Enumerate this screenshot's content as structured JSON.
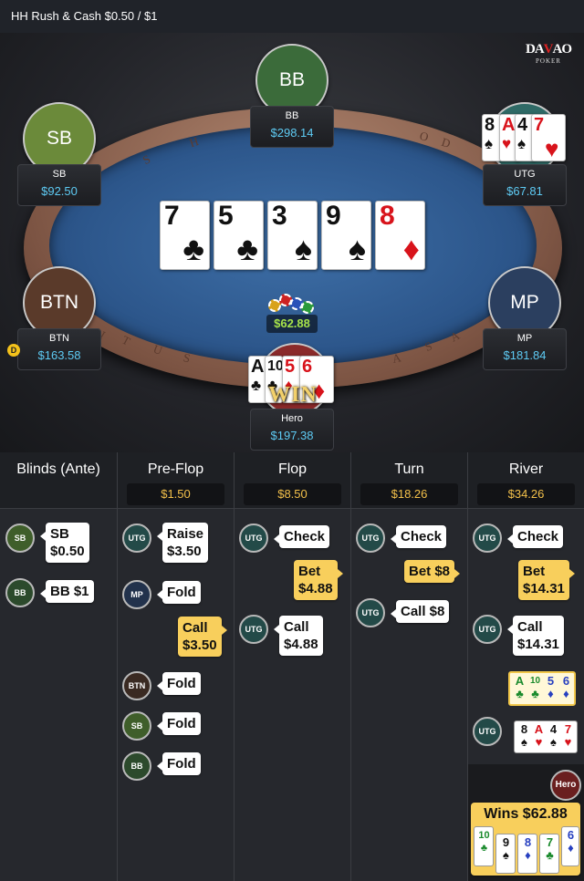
{
  "title": "HH  Rush & Cash $0.50 / $1",
  "logo": {
    "text_a": "DA",
    "text_b": "V",
    "text_c": "AO",
    "sub": "POKER"
  },
  "rail_text": [
    "S",
    "H",
    "O",
    "D",
    "I",
    "T",
    "U",
    "S",
    "A",
    "S",
    "A"
  ],
  "seats": {
    "bb": {
      "avatar": "BB",
      "name": "BB",
      "stack": "$298.14",
      "color": "#3b6b3a"
    },
    "sb": {
      "avatar": "SB",
      "name": "SB",
      "stack": "$92.50",
      "color": "#6b8a3a"
    },
    "utg": {
      "name": "UTG",
      "stack": "$67.81",
      "color": "#2f6a66"
    },
    "btn": {
      "avatar": "BTN",
      "name": "BTN",
      "stack": "$163.58",
      "color": "#5a3a2a"
    },
    "mp": {
      "avatar": "MP",
      "name": "MP",
      "stack": "$181.84",
      "color": "#2b3f5f"
    },
    "hero": {
      "name": "Hero",
      "stack": "$197.38",
      "color": "#8a2a2a"
    }
  },
  "board": [
    {
      "rank": "7",
      "suit": "♣",
      "color": "blk"
    },
    {
      "rank": "5",
      "suit": "♣",
      "color": "blk"
    },
    {
      "rank": "3",
      "suit": "♠",
      "color": "blk"
    },
    {
      "rank": "9",
      "suit": "♠",
      "color": "blk"
    },
    {
      "rank": "8",
      "suit": "♦",
      "color": "red"
    }
  ],
  "utg_hand": [
    {
      "rank": "8",
      "suit": "♠",
      "color": "blk"
    },
    {
      "rank": "A",
      "suit": "♥",
      "color": "red"
    },
    {
      "rank": "4",
      "suit": "♠",
      "color": "blk"
    },
    {
      "rank": "7",
      "suit": "♥",
      "color": "red"
    }
  ],
  "hero_hand": [
    {
      "rank": "A",
      "suit": "♣",
      "color": "blk"
    },
    {
      "rank": "10",
      "suit": "♣",
      "color": "blk"
    },
    {
      "rank": "5",
      "suit": "♦",
      "color": "red"
    },
    {
      "rank": "6",
      "suit": "♦",
      "color": "red"
    }
  ],
  "pot": "$62.88",
  "dealer": "D",
  "win_label": "WIN",
  "columns": [
    {
      "title": "Blinds (Ante)",
      "pot": ""
    },
    {
      "title": "Pre-Flop",
      "pot": "$1.50"
    },
    {
      "title": "Flop",
      "pot": "$8.50"
    },
    {
      "title": "Turn",
      "pot": "$18.26"
    },
    {
      "title": "River",
      "pot": "$34.26"
    }
  ],
  "actions": {
    "blinds": [
      {
        "pos": "SB",
        "l1": "SB",
        "l2": "$0.50"
      },
      {
        "pos": "BB",
        "l1": "BB  $1"
      }
    ],
    "preflop": [
      {
        "pos": "UTG",
        "l1": "Raise",
        "l2": "$3.50"
      },
      {
        "pos": "MP",
        "l1": "Fold"
      },
      {
        "l1": "Call",
        "l2": "$3.50"
      },
      {
        "pos": "BTN",
        "l1": "Fold"
      },
      {
        "pos": "SB",
        "l1": "Fold"
      },
      {
        "pos": "BB",
        "l1": "Fold"
      }
    ],
    "flop": [
      {
        "pos": "UTG",
        "l1": "Check"
      },
      {
        "l1": "Bet",
        "l2": "$4.88"
      },
      {
        "pos": "UTG",
        "l1": "Call",
        "l2": "$4.88"
      }
    ],
    "turn": [
      {
        "pos": "UTG",
        "l1": "Check"
      },
      {
        "l1": "Bet  $8"
      },
      {
        "pos": "UTG",
        "l1": "Call  $8"
      }
    ],
    "river": [
      {
        "pos": "UTG",
        "l1": "Check"
      },
      {
        "l1": "Bet",
        "l2": "$14.31"
      },
      {
        "pos": "UTG",
        "l1": "Call",
        "l2": "$14.31"
      }
    ]
  },
  "river_hero_cards": [
    {
      "rank": "A",
      "suit": "♣",
      "color": "grn"
    },
    {
      "rank": "10",
      "suit": "♣",
      "color": "grn"
    },
    {
      "rank": "5",
      "suit": "♦",
      "color": "blu"
    },
    {
      "rank": "6",
      "suit": "♦",
      "color": "blu"
    }
  ],
  "river_utg_cards": [
    {
      "rank": "8",
      "suit": "♠",
      "color": "blk"
    },
    {
      "rank": "A",
      "suit": "♥",
      "color": "red"
    },
    {
      "rank": "4",
      "suit": "♠",
      "color": "blk"
    },
    {
      "rank": "7",
      "suit": "♥",
      "color": "red"
    }
  ],
  "hero_result": {
    "pos": "Hero",
    "label": "Wins $62.88"
  },
  "winning_cards": [
    {
      "rank": "10",
      "suit": "♣",
      "color": "grn"
    },
    {
      "rank": "9",
      "suit": "♠",
      "color": "blk"
    },
    {
      "rank": "8",
      "suit": "♦",
      "color": "blu"
    },
    {
      "rank": "7",
      "suit": "♣",
      "color": "grn"
    },
    {
      "rank": "6",
      "suit": "♦",
      "color": "blu"
    }
  ]
}
